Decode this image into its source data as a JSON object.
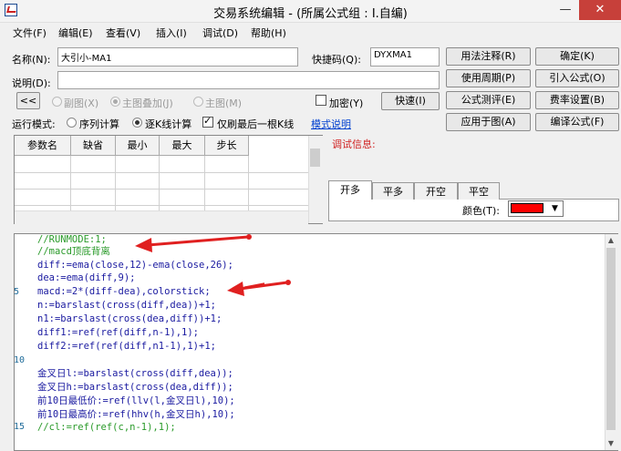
{
  "window": {
    "title": "交易系统编辑 - (所属公式组 : I.自编)",
    "minimize": "—",
    "close": "✕"
  },
  "menu": [
    "文件(F)",
    "编辑(E)",
    "查看(V)",
    "插入(I)",
    "调试(D)",
    "帮助(H)"
  ],
  "form": {
    "name_label": "名称(N):",
    "name_value": "大引小-MA1",
    "hotkey_label": "快捷码(Q):",
    "hotkey_value": "DYXMA1",
    "desc_label": "说明(D):",
    "desc_value": "",
    "collapse_btn": "<<",
    "radio_sub": "副图(X)",
    "radio_main_overlay": "主图叠加(J)",
    "radio_main": "主图(M)",
    "encrypt_label": "加密(Y)",
    "fast_btn": "快速(I)",
    "run_mode_label": "运行模式:",
    "mode_seq": "序列计算",
    "mode_bar": "逐K线计算",
    "last_bar_label": "仅刷最后一根K线",
    "mode_help_link": "模式说明"
  },
  "buttons": {
    "usage_note": "用法注释(R)",
    "confirm": "确定(K)",
    "usage_period": "使用周期(P)",
    "import": "引入公式(O)",
    "test": "公式测评(E)",
    "fee": "费率设置(B)",
    "apply": "应用于图(A)",
    "compile": "编译公式(F)"
  },
  "params_table": {
    "headers": [
      "参数名",
      "缺省",
      "最小",
      "最大",
      "步长"
    ],
    "rows": []
  },
  "debug": {
    "label": "调试信息:"
  },
  "signal_tabs": {
    "items": [
      "开多",
      "平多",
      "开空",
      "平空"
    ],
    "color_label": "颜色(T):",
    "color": "#ff0000"
  },
  "line_numbers": [
    "5",
    "10",
    "15"
  ],
  "code_lines": [
    "//RUNMODE:1;",
    "//macd顶底背离",
    "diff:=ema(close,12)-ema(close,26);",
    "dea:=ema(diff,9);",
    "macd:=2*(diff-dea),colorstick;",
    "n:=barslast(cross(diff,dea))+1;",
    "n1:=barslast(cross(dea,diff))+1;",
    "diff1:=ref(ref(diff,n-1),1);",
    "diff2:=ref(ref(diff,n1-1),1)+1;",
    "",
    "金叉日l:=barslast(cross(diff,dea));",
    "金叉日h:=barslast(cross(dea,diff));",
    "前10日最低价:=ref(llv(l,金叉日l),10);",
    "前10日最高价:=ref(hhv(h,金叉日h),10);",
    "//cl:=ref(ref(c,n-1),1);"
  ],
  "colors": {
    "accent_arrow": "#e02020",
    "comment": "#2a9a2a",
    "function": "#0000d8"
  }
}
